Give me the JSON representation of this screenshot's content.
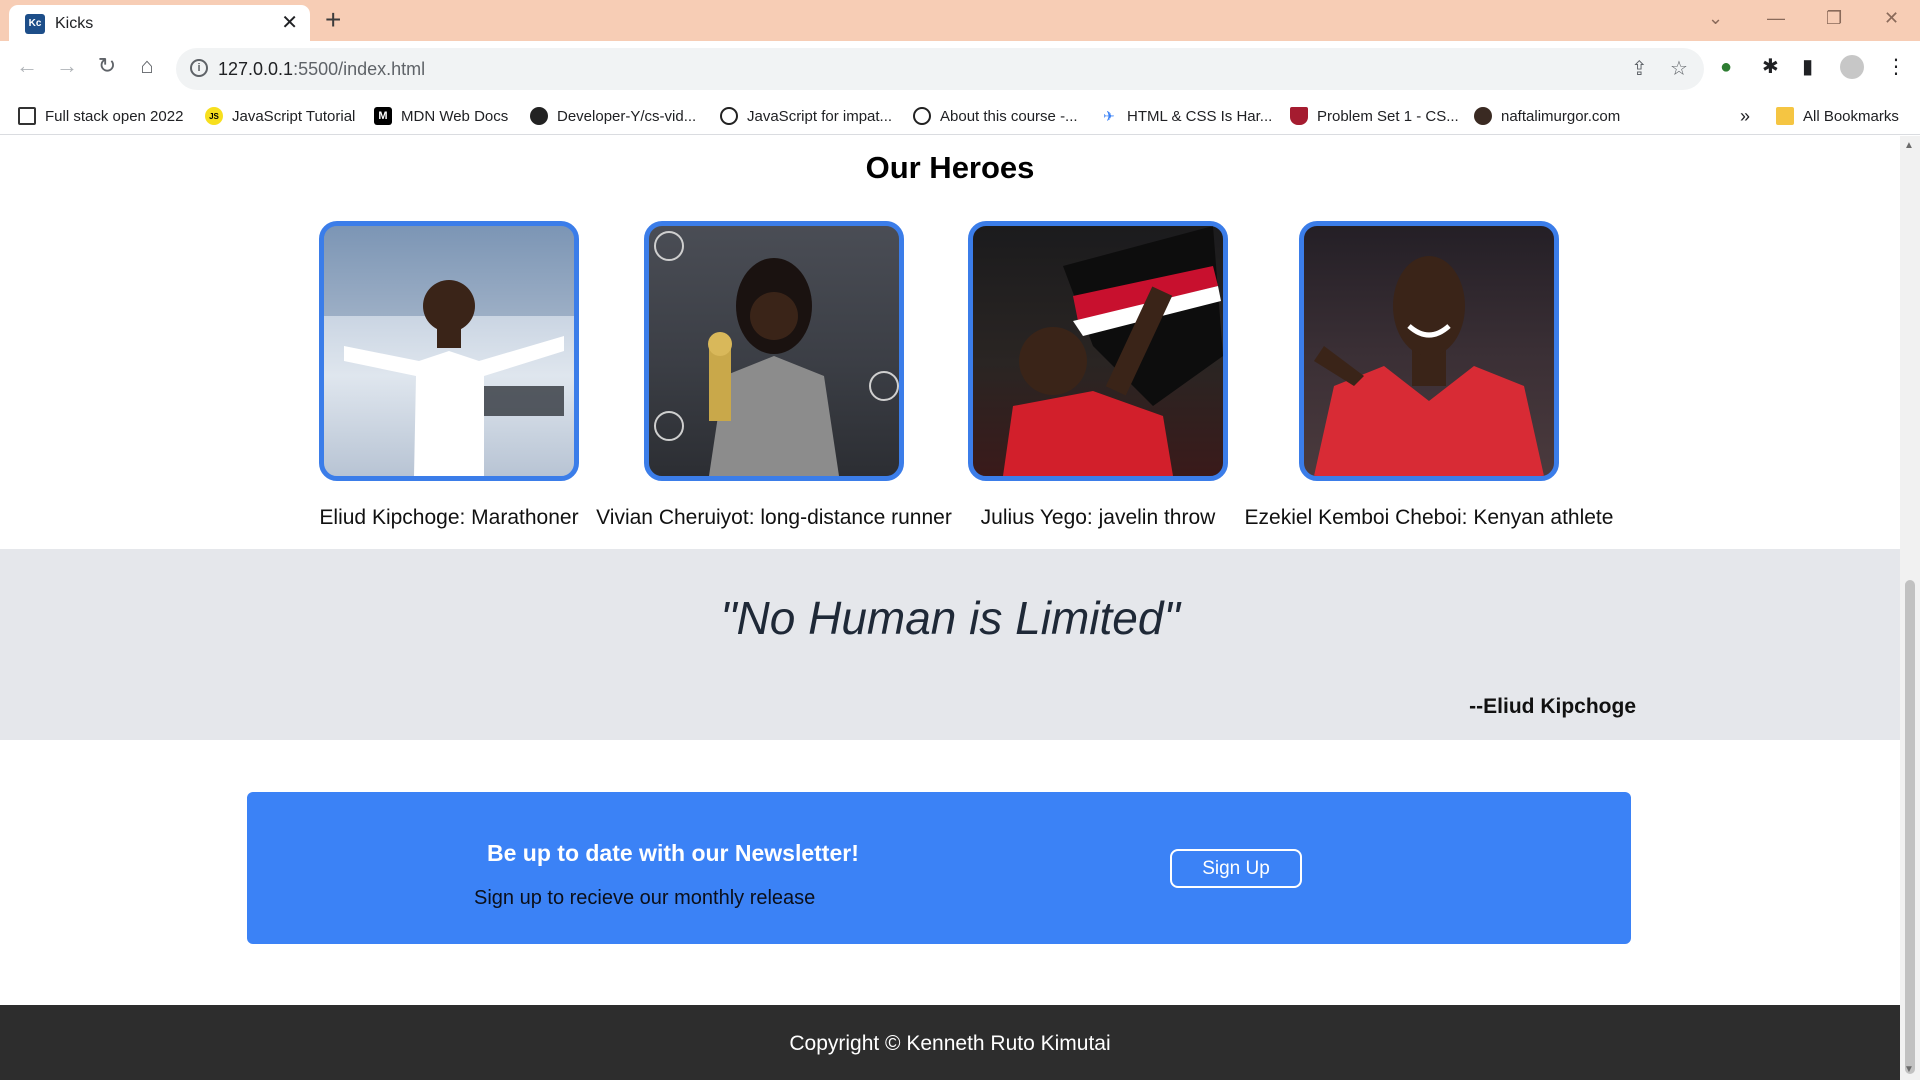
{
  "browser": {
    "tab_title": "Kicks",
    "tab_favicon_text": "Kc",
    "url_host": "127.0.0.1",
    "url_rest": ":5500/index.html",
    "bookmarks": [
      {
        "label": "Full stack open 2022",
        "icon": "page-icon"
      },
      {
        "label": "JavaScript Tutorial",
        "icon": "js-icon",
        "icon_text": "JS"
      },
      {
        "label": "MDN Web Docs",
        "icon": "mdn-icon",
        "icon_text": "M"
      },
      {
        "label": "Developer-Y/cs-vid...",
        "icon": "github-icon"
      },
      {
        "label": "JavaScript for impat...",
        "icon": "globe-icon"
      },
      {
        "label": "About this course -...",
        "icon": "globe-icon"
      },
      {
        "label": "HTML & CSS Is Har...",
        "icon": "plane-icon"
      },
      {
        "label": "Problem Set 1 - CS...",
        "icon": "shield-icon"
      },
      {
        "label": "naftalimurgor.com",
        "icon": "person-icon"
      }
    ],
    "more_bookmarks": "»",
    "all_bookmarks": "All Bookmarks"
  },
  "heroes": {
    "title": "Our Heroes",
    "items": [
      {
        "caption": "Eliud Kipchoge: Marathoner",
        "photo": "eliud-kipchoge-photo"
      },
      {
        "caption": "Vivian Cheruiyot: long-distance runner",
        "photo": "vivian-cheruiyot-photo"
      },
      {
        "caption": "Julius Yego: javelin throw",
        "photo": "julius-yego-photo"
      },
      {
        "caption": "Ezekiel Kemboi Cheboi: Kenyan athlete",
        "photo": "ezekiel-kemboi-photo"
      }
    ]
  },
  "quote": {
    "text": "\"No Human is Limited\"",
    "author": "--Eliud Kipchoge"
  },
  "newsletter": {
    "title": "Be up to date with our Newsletter!",
    "subtitle": "Sign up to recieve our monthly release",
    "button": "Sign Up"
  },
  "footer": {
    "text": "Copyright © Kenneth Ruto Kimutai"
  },
  "colors": {
    "accent": "#3b82f6",
    "photo_border": "#3b7de9",
    "quote_band": "#e5e7eb",
    "footer": "#2d2d2d"
  }
}
